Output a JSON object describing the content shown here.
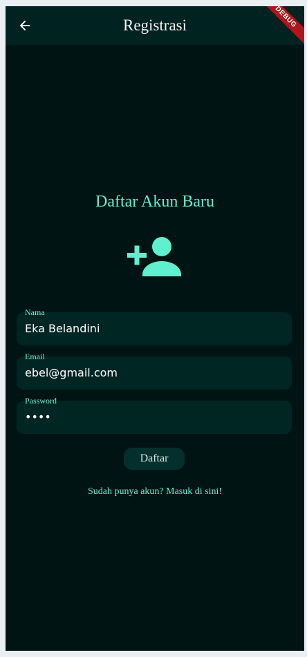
{
  "appbar": {
    "title": "Registrasi",
    "back_icon": "arrow-back-icon",
    "debug_label": "DEBUG"
  },
  "main": {
    "heading": "Daftar Akun Baru",
    "header_icon": "person-add-icon",
    "fields": {
      "name": {
        "label": "Nama",
        "value": "Eka Belandini"
      },
      "email": {
        "label": "Email",
        "value": "ebel@gmail.com"
      },
      "password": {
        "label": "Password",
        "value": "eka1"
      }
    },
    "submit_label": "Daftar",
    "login_link": "Sudah punya akun? Masuk di sini!"
  },
  "colors": {
    "background": "#001413",
    "appbar": "#002220",
    "accent": "#5ff0cf",
    "field_fill": "#002624",
    "debug_banner": "#b2151b"
  }
}
